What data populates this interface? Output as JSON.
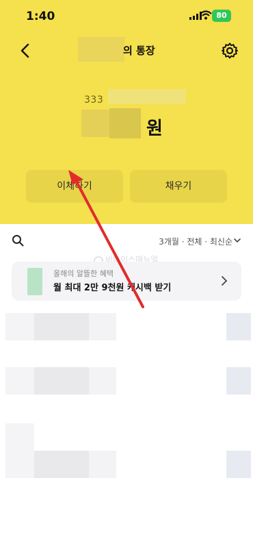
{
  "status_bar": {
    "time": "1:40",
    "battery": "80"
  },
  "nav": {
    "title": "의 통장"
  },
  "account": {
    "number_prefix": "333",
    "balance_unit": "원"
  },
  "actions": {
    "transfer_label": "이체하기",
    "fill_label": "채우기"
  },
  "filter": {
    "label": "3개월 · 전체 · 최신순"
  },
  "banner": {
    "subtitle": "올해의 알뜰한 혜택",
    "title": "월 최대 2만 9천원 캐시백 받기"
  },
  "watermark": {
    "text": "비바이스매뉴얼"
  },
  "colors": {
    "accent": "#f5e04d",
    "annotation_arrow": "#e22b2b"
  },
  "icons": [
    "back-arrow-icon",
    "gear-icon",
    "search-icon",
    "chevron-down-icon",
    "chevron-right-icon",
    "wifi-icon",
    "signal-icon",
    "battery-icon"
  ]
}
